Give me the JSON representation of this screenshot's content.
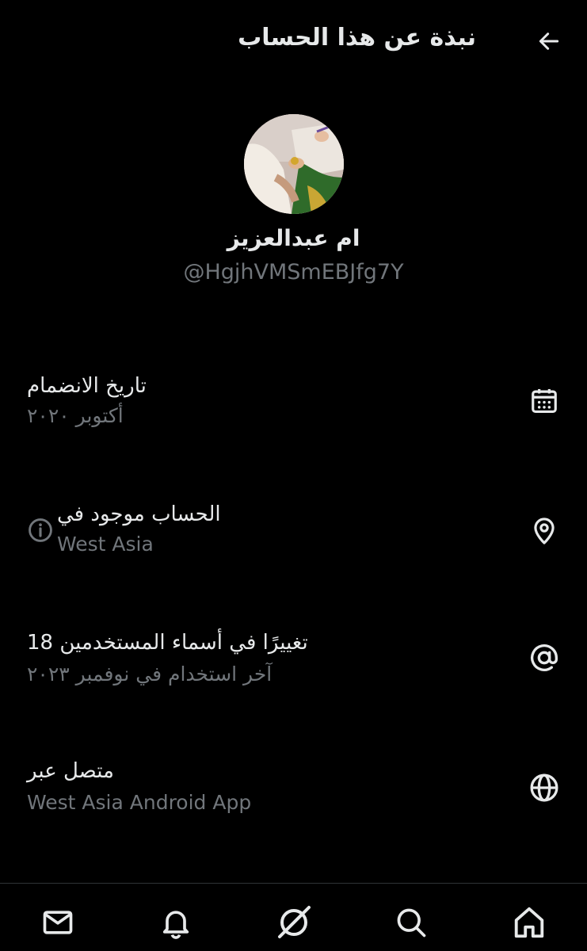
{
  "header": {
    "title": "نبذة عن هذا الحساب",
    "back_icon": "arrow-left-icon"
  },
  "profile": {
    "display_name": "ام عبدالعزيز",
    "handle": "@HgjhVMSmEBJfg7Y"
  },
  "rows": [
    {
      "title": "تاريخ الانضمام",
      "subtitle": "أكتوبر ٢٠٢٠",
      "icon": "calendar-icon"
    },
    {
      "title": "الحساب موجود في",
      "subtitle": "West Asia",
      "icon": "location-pin-icon",
      "extra_icon": "info-icon"
    },
    {
      "title": "تغييرًا في أسماء المستخدمين 18",
      "subtitle": "آخر استخدام في نوفمبر ٢٠٢٣",
      "icon": "at-sign-icon"
    },
    {
      "title": "متصل عبر",
      "subtitle": "West Asia Android App",
      "icon": "globe-icon"
    }
  ],
  "bottom_nav": [
    "mail-icon",
    "bell-icon",
    "grok-icon",
    "search-icon",
    "home-icon"
  ],
  "colors": {
    "background": "#000000",
    "text_primary": "#e7e9ea",
    "text_secondary": "#71767b",
    "divider": "#2f3336"
  }
}
